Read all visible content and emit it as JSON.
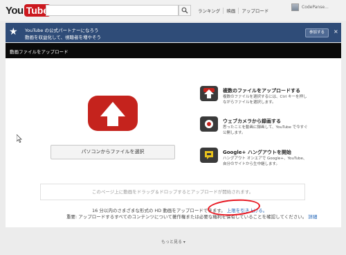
{
  "header": {
    "logo_you": "You",
    "logo_tube": "Tube",
    "search_value": "",
    "nav": [
      "ランキング",
      "映画",
      "アップロード"
    ],
    "username": "CodePanse..."
  },
  "banner": {
    "line1": "YouTube の公式パートナーになろう",
    "line2": "動画を収益化して、視聴者を増やそう",
    "join_label": "参加する",
    "close": "×"
  },
  "upload": {
    "panel_title": "動画ファイルをアップロード",
    "select_button": "パソコンからファイルを選択",
    "options": [
      {
        "title": "複数のファイルをアップロードする",
        "desc": "複数のファイルを選択するには、Ctrl キーを押しながらファイルを選択します。",
        "icon": "upload-arrow-icon"
      },
      {
        "title": "ウェブカメラから録画する",
        "desc": "思ったことを動画に録画して、YouTube で今すぐ公開します。",
        "icon": "record-icon"
      },
      {
        "title": "Google+ ハングアウトを開始",
        "desc": "ハングアウト オンエアで Google+、YouTube、自分のサイトから生中継します。",
        "icon": "hangout-icon"
      }
    ],
    "dropzone_text": "このページ上に動画をドラッグ＆ドロップするとアップロードが開始されます。",
    "info1_text": "16 分以内のさまざまな形式の HD 動画をアップロードできます。",
    "info1_link": "上限を引き上げる。",
    "info2_text": "重要: アップロードするすべてのコンテンツについて著作権または必要な権利を保有していることを確認してください。",
    "info2_link": "詳細"
  },
  "footer": {
    "more": "もっと見る ▾"
  },
  "colors": {
    "brand_red": "#cc181e",
    "banner_blue": "#2f4c78",
    "annotation_red": "#e8141e"
  }
}
